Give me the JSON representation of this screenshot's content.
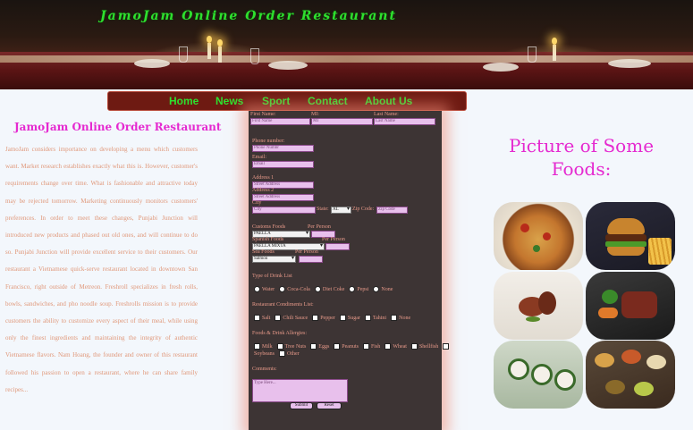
{
  "banner": {
    "title": "JamoJam Online Order Restaurant"
  },
  "nav": [
    "Home",
    "News",
    "Sport",
    "Contact",
    "About Us"
  ],
  "intro": {
    "title": "JamoJam Online Order Restaurant",
    "text": "JamoJam considers importance on developing a menu which customers want. Market research establishes exactly what this is. However, customer's requirements change over time. What is fashionable and attractive today may be rejected tomorrow. Marketing continuously monitors customers' preferences. In order to meet these changes, Punjabi Junction will introduced new products and phased out old ones, and will continue to do so. Punjabi Junction will provide excellent service to their customers. Our restaurant a Vietnamese quick-serve restaurant located in downtown San Francisco, right outside of Metreon. Freshroll specializes in fresh rolls, bowls, sandwiches, and pho noodle soup. Freshrolls mission is to provide customers the ability to customize every aspect of their meal, while using only the finest ingredients and maintaining the integrity of authentic Vietnamese flavors. Nam Hoang, the founder and owner of this restaurant followed his passion to open a restaurant, where he can share family recipes..."
  },
  "form": {
    "first_name_label": "First Name:",
    "mi_label": "MI:",
    "last_name_label": "Last Name:",
    "first_name_ph": "First Name",
    "mi_ph": "MI",
    "last_name_ph": "Last Name",
    "phone_label": "Phone number:",
    "phone_ph": "Phone Numbr",
    "email_label": "Email:",
    "email_ph": "Email",
    "address1_label": "Address 1",
    "address1_ph": "Street Address",
    "address2_label": "Address 2",
    "address2_ph": "Street Address",
    "city_label": "City",
    "city_ph": "City",
    "state_label": "State:",
    "state_value": "AL",
    "zip_label": "Zip Code:",
    "zip_ph": "Zip Code",
    "customs_label": "Customs Foods",
    "per_person_1": "Per Person",
    "customs_value": "PAELLA",
    "spanish_label": "Spanish Foods",
    "per_person_2": "Per Person",
    "spanish_value": "PAELLA MIXTA",
    "sea_label": "Sea Foods",
    "per_person_3": "Per Person",
    "sea_value": "Salmon",
    "drink_label": "Type of Drink List",
    "drinks": [
      "Water",
      "Coca-Cola",
      "Diet Coke",
      "Pepsi",
      "None"
    ],
    "condiments_label": "Restaurant Condiments List:",
    "condiments": [
      "Salt",
      "Chili Sauce",
      "Pepper",
      "Sugar",
      "Tahini",
      "None"
    ],
    "allergies_label": "Foods & Drink Allergies:",
    "allergies": [
      "Milk",
      "Tree Nuts",
      "Eggs",
      "Peanuts",
      "Fish",
      "Wheat",
      "Shellfish",
      "Soybeans",
      "Other"
    ],
    "comments_label": "Comments:",
    "comments_ph": "Type Here...",
    "submit": "Submit",
    "reset": "Reset"
  },
  "pictures": {
    "title": "Picture of Some Foods:",
    "items": [
      "pizza-photo",
      "burger-fries-photo",
      "lamb-chops-photo",
      "steak-vegetables-photo",
      "sushi-rolls-photo",
      "bowls-spread-photo"
    ]
  },
  "colors": {
    "accent": "#e52ad0",
    "nav_text": "#2ee02e",
    "nav_bg": "#6e1a12",
    "form_bg": "#3d3434",
    "input_bg": "#e8c0ec",
    "body_text": "#e0987a"
  }
}
